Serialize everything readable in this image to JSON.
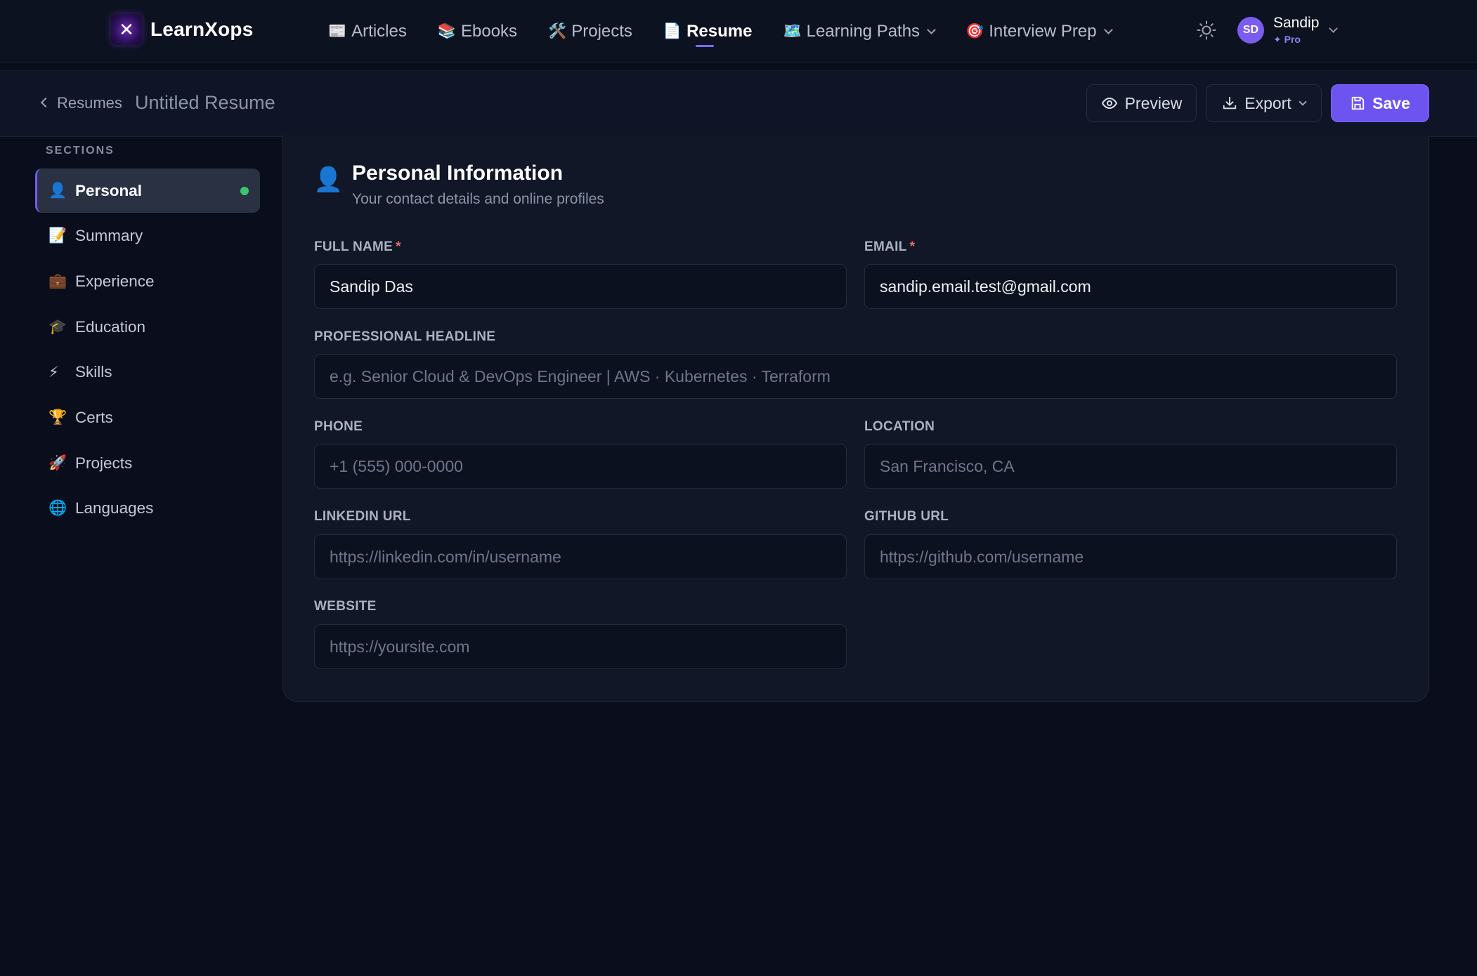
{
  "app": {
    "brand": "LearnXops"
  },
  "nav": {
    "items": [
      {
        "emoji": "📰",
        "label": "Articles"
      },
      {
        "emoji": "📚",
        "label": "Ebooks"
      },
      {
        "emoji": "🛠️",
        "label": "Projects"
      },
      {
        "emoji": "📄",
        "label": "Resume"
      },
      {
        "emoji": "🗺️",
        "label": "Learning Paths"
      },
      {
        "emoji": "🎯",
        "label": "Interview Prep"
      }
    ],
    "active": "Resume"
  },
  "user": {
    "initials": "SD",
    "name": "Sandip",
    "plan": "✦ Pro"
  },
  "subheader": {
    "back_label": "Resumes",
    "title": "Untitled Resume",
    "preview_label": "Preview",
    "export_label": "Export",
    "save_label": "Save"
  },
  "sidebar": {
    "heading": "SECTIONS",
    "items": [
      {
        "emoji": "👤",
        "label": "Personal"
      },
      {
        "emoji": "📝",
        "label": "Summary"
      },
      {
        "emoji": "💼",
        "label": "Experience"
      },
      {
        "emoji": "🎓",
        "label": "Education"
      },
      {
        "emoji": "⚡",
        "label": "Skills"
      },
      {
        "emoji": "🏆",
        "label": "Certs"
      },
      {
        "emoji": "🚀",
        "label": "Projects"
      },
      {
        "emoji": "🌐",
        "label": "Languages"
      }
    ]
  },
  "form": {
    "icon": "👤",
    "title": "Personal Information",
    "subtitle": "Your contact details and online profiles",
    "full_name": {
      "label": "FULL NAME",
      "required": "*",
      "value": "Sandip Das"
    },
    "email": {
      "label": "EMAIL",
      "required": "*",
      "value": "sandip.email.test@gmail.com"
    },
    "headline": {
      "label": "PROFESSIONAL HEADLINE",
      "placeholder": "e.g. Senior Cloud & DevOps Engineer | AWS · Kubernetes · Terraform"
    },
    "phone": {
      "label": "PHONE",
      "placeholder": "+1 (555) 000-0000"
    },
    "location": {
      "label": "LOCATION",
      "placeholder": "San Francisco, CA"
    },
    "linkedin": {
      "label": "LINKEDIN URL",
      "placeholder": "https://linkedin.com/in/username"
    },
    "github": {
      "label": "GITHUB URL",
      "placeholder": "https://github.com/username"
    },
    "website": {
      "label": "WEBSITE",
      "placeholder": "https://yoursite.com"
    }
  },
  "colors": {
    "accent": "#6d54f0",
    "background": "#0a0e1c",
    "status_ok": "#3ec46d",
    "required": "#f06565"
  },
  "icons": {
    "theme": "sun-icon",
    "back": "chevron-left-icon",
    "preview": "eye-icon",
    "export": "download-icon",
    "save": "floppy-disk-icon"
  }
}
